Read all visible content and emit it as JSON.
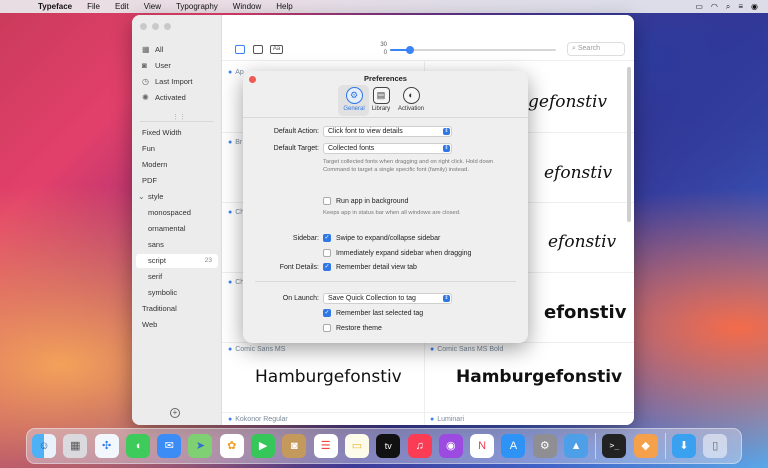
{
  "menubar": {
    "app": "Typeface",
    "items": [
      "File",
      "Edit",
      "View",
      "Typography",
      "Window",
      "Help"
    ]
  },
  "sidebar": {
    "items": [
      {
        "label": "All",
        "icon": "grid-icon"
      },
      {
        "label": "User",
        "icon": "person-icon"
      },
      {
        "label": "Last Import",
        "icon": "clock-icon"
      },
      {
        "label": "Activated",
        "icon": "sun-icon"
      }
    ],
    "tags": [
      {
        "label": "Fixed Width"
      },
      {
        "label": "Fun"
      },
      {
        "label": "Modern"
      },
      {
        "label": "PDF"
      },
      {
        "label": "style",
        "prefix": "⌄"
      },
      {
        "label": "monospaced"
      },
      {
        "label": "ornamental"
      },
      {
        "label": "sans"
      },
      {
        "label": "script",
        "count": "23",
        "selected": true
      },
      {
        "label": "serif"
      },
      {
        "label": "symbolic"
      },
      {
        "label": "Traditional"
      },
      {
        "label": "Web"
      }
    ]
  },
  "toolbar": {
    "slider_value": "30",
    "slider_min": "0",
    "slider_fraction": 0.12,
    "search_placeholder": "Search"
  },
  "cards": [
    {
      "label": "Ap",
      "sample": "Hamburgefonstiv"
    },
    {
      "label": "Br",
      "sample": "Hamburgefonstiv"
    },
    {
      "label": "Ch",
      "sample": "Hamburgefonstiv"
    },
    {
      "label": "Ch",
      "sample": "Hamburgefonstiv"
    },
    {
      "label": "Comic Sans MS",
      "sample": "Hamburgefonstiv"
    },
    {
      "label": "Comic Sans MS Bold",
      "sample": "Hamburgefonstiv"
    },
    {
      "label": "Kokonor Regular",
      "sample": ""
    },
    {
      "label": "Luminari",
      "sample": ""
    }
  ],
  "right_samples": [
    "gefonstiv",
    "efonstiv",
    "efonstiv",
    "efonstiv"
  ],
  "prefs": {
    "title": "Preferences",
    "tabs": [
      {
        "label": "General"
      },
      {
        "label": "Library"
      },
      {
        "label": "Activation"
      }
    ],
    "default_action_label": "Default Action:",
    "default_action_value": "Click font to view details",
    "default_target_label": "Default Target:",
    "default_target_value": "Collected fonts",
    "target_help": "Target collected fonts when dragging and on right click. Hold down Command to target a single specific font (family) instead.",
    "run_bg": "Run app in background",
    "run_bg_help": "Keeps app in status bar when all windows are closed.",
    "sidebar_label": "Sidebar:",
    "swipe": "Swipe to expand/collapse sidebar",
    "expand_drag": "Immediately expand sidebar when dragging",
    "font_details_label": "Font Details:",
    "remember_tab": "Remember detail view tab",
    "on_launch_label": "On Launch:",
    "on_launch_value": "Save Quick Collection to tag",
    "remember_tag": "Remember last selected tag",
    "restore_theme": "Restore theme"
  },
  "dock": {
    "apps": [
      "finder-icon",
      "launchpad-icon",
      "safari-icon",
      "messages-icon",
      "mail-icon",
      "maps-icon",
      "photos-icon",
      "facetime-icon",
      "contacts-icon",
      "reminders-icon",
      "notes-icon",
      "tv-icon",
      "music-icon",
      "podcasts-icon",
      "news-icon",
      "appstore-icon",
      "settings-icon",
      "typeface-icon",
      "terminal-icon",
      "fox-icon",
      "downloads-icon",
      "trash-icon"
    ],
    "tv_label": "tv"
  }
}
